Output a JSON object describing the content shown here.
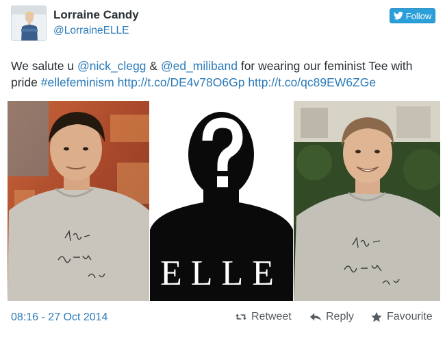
{
  "user": {
    "name": "Lorraine Candy",
    "handle": "@LorraineELLE"
  },
  "follow_label": "Follow",
  "tweet": {
    "t1": "We salute u ",
    "mention1": "@nick_clegg",
    "t2": " & ",
    "mention2": "@ed_miliband",
    "t3": " for wearing our feminist Tee with pride ",
    "hashtag": "#ellefeminism",
    "t4": " ",
    "link1": "http://t.co/DE4v78O6Gp",
    "t5": " ",
    "link2": "http://t.co/qc89EW6ZGe"
  },
  "media": {
    "elle_logo": "ELLE",
    "tee_slogan": "This is what a feminist looks like"
  },
  "footer": {
    "timestamp": "08:16 - 27 Oct 2014",
    "retweet_label": "Retweet",
    "reply_label": "Reply",
    "favourite_label": "Favourite"
  },
  "colors": {
    "link": "#2b7bb9",
    "follow_button": "#2b9fd9",
    "text": "#292f33",
    "muted": "#555c61"
  },
  "icons": [
    "twitter-bird-icon",
    "retweet-icon",
    "reply-icon",
    "star-icon"
  ]
}
